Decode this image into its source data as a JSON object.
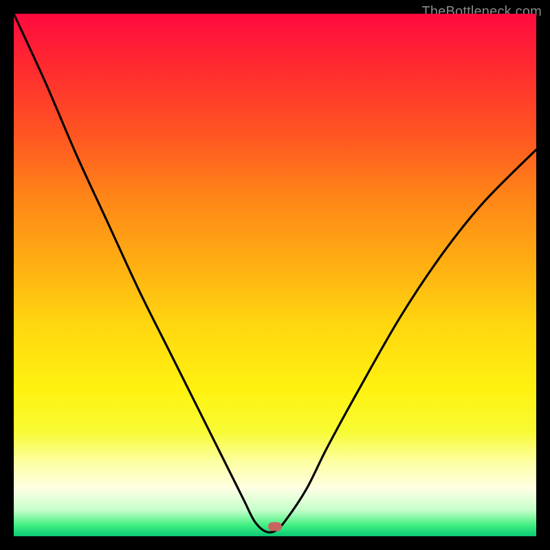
{
  "watermark": "TheBottleneck.com",
  "chart_data": {
    "type": "line",
    "title": "",
    "xlabel": "",
    "ylabel": "",
    "xlim": [
      0,
      100
    ],
    "ylim": [
      0,
      100
    ],
    "series": [
      {
        "name": "bottleneck-curve",
        "x": [
          0,
          6,
          12,
          18,
          24,
          30,
          36,
          40,
          44,
          46,
          48,
          50,
          52,
          56,
          60,
          66,
          74,
          82,
          90,
          100
        ],
        "y": [
          100,
          87,
          73,
          60,
          47,
          35,
          23,
          15,
          7,
          3,
          1,
          1,
          3,
          9,
          17,
          28,
          42,
          54,
          64,
          74
        ]
      }
    ],
    "flat_bottom": {
      "x_start": 46,
      "x_end": 52,
      "y": 1
    },
    "marker": {
      "x": 50,
      "y": 1.8,
      "color": "#c86460"
    },
    "gradient_stops": [
      {
        "pct": 0,
        "color": "#ff0a3e"
      },
      {
        "pct": 10,
        "color": "#ff2a30"
      },
      {
        "pct": 23,
        "color": "#ff5522"
      },
      {
        "pct": 35,
        "color": "#ff8518"
      },
      {
        "pct": 48,
        "color": "#ffaf12"
      },
      {
        "pct": 60,
        "color": "#ffd810"
      },
      {
        "pct": 72,
        "color": "#fff210"
      },
      {
        "pct": 80,
        "color": "#f7fb34"
      },
      {
        "pct": 86,
        "color": "#fdffa6"
      },
      {
        "pct": 91,
        "color": "#fdffe5"
      },
      {
        "pct": 95,
        "color": "#c5ffc9"
      },
      {
        "pct": 98,
        "color": "#3cee7f"
      },
      {
        "pct": 100,
        "color": "#0bc876"
      }
    ]
  }
}
